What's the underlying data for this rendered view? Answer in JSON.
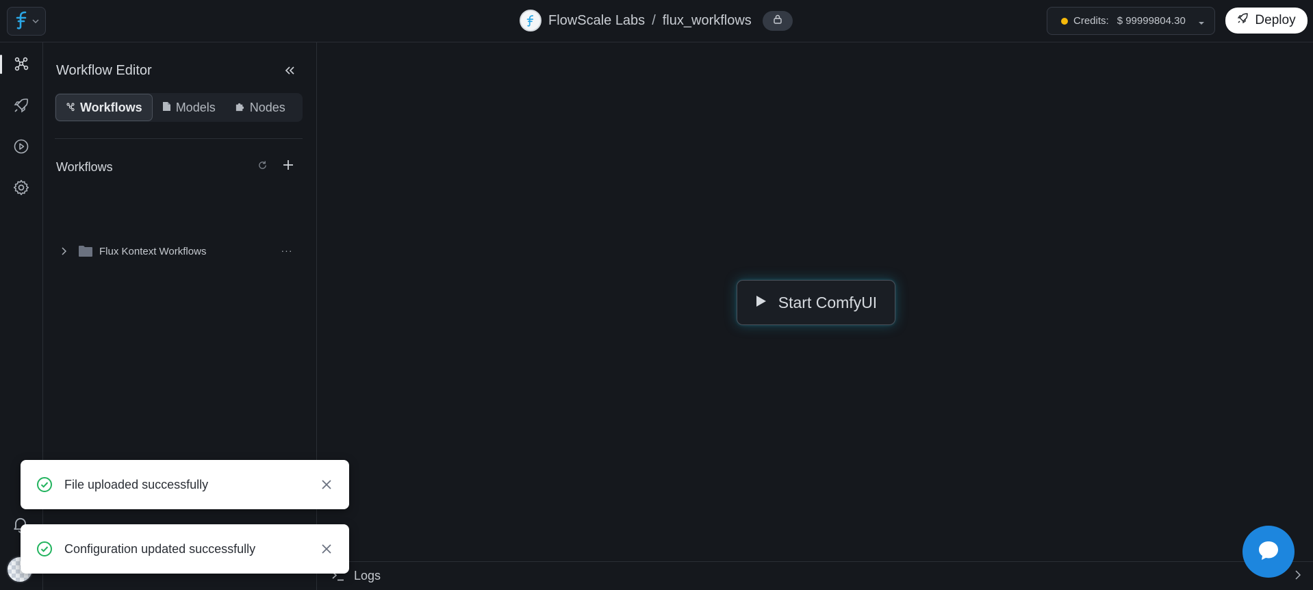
{
  "header": {
    "org_name": "FlowScale Labs",
    "separator": "/",
    "project_name": "flux_workflows",
    "credits_label": "Credits:",
    "credits_value": "$ 99999804.30",
    "deploy_label": "Deploy"
  },
  "panel": {
    "title": "Workflow Editor",
    "tabs": [
      {
        "label": "Workflows",
        "icon": "workflow-icon",
        "active": true
      },
      {
        "label": "Models",
        "icon": "file-icon",
        "active": false
      },
      {
        "label": "Nodes",
        "icon": "puzzle-icon",
        "active": false
      }
    ],
    "section_title": "Workflows",
    "tree": [
      {
        "label": "Flux Kontext Workflows",
        "type": "folder",
        "expanded": false
      }
    ]
  },
  "main": {
    "start_label": "Start ComfyUI",
    "logs_label": "Logs"
  },
  "toasts": [
    {
      "message": "File uploaded successfully"
    },
    {
      "message": "Configuration updated successfully"
    }
  ],
  "colors": {
    "background": "#15181d",
    "accent_glow": "#26aac8",
    "success": "#22b35e",
    "chat": "#1d86de",
    "credit_dot": "#f5b90a"
  }
}
